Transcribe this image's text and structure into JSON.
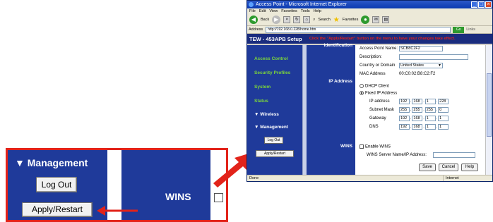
{
  "browser": {
    "title": "Access Point - Microsoft Internet Explorer",
    "menu": [
      "File",
      "Edit",
      "View",
      "Favorites",
      "Tools",
      "Help"
    ],
    "toolbar": {
      "back": "Back",
      "search": "Search",
      "favorites": "Favorites"
    },
    "address_label": "Address",
    "address_value": "http://192.168.0.228/home.htm",
    "go_label": "Go",
    "links_label": "Links",
    "status_left": "Done",
    "status_zone": "Internet"
  },
  "header": {
    "model": "TEW - 453APB Setup",
    "notice": "Click the \"Apply/Restart\" button on the menu to have your changes take effect."
  },
  "nav": {
    "items": [
      "Access Control",
      "Security Profiles",
      "System",
      "Status",
      "▼ Wireless",
      "▼ Management"
    ],
    "logout_label": "Log Out",
    "apply_label": "Apply/Restart"
  },
  "sections": {
    "identification": "Identification",
    "ip_address": "IP Address",
    "wins": "WINS"
  },
  "form": {
    "ap_name_label": "Access Point Name:",
    "ap_name_value": "SCB8C2F2",
    "description_label": "Description:",
    "description_value": "",
    "country_label": "Country or Domain",
    "country_value": "United States",
    "mac_label": "MAC Address",
    "mac_value": "00:C0:02:B8:C2:F2",
    "dhcp_label": "DHCP Client",
    "fixed_label": "Fixed IP Address",
    "ip_label": "IP address",
    "ip_value": [
      "192",
      "168",
      "1",
      "228"
    ],
    "mask_label": "Subnet Mask",
    "mask_value": [
      "255",
      "255",
      "255",
      "0"
    ],
    "gateway_label": "Gateway",
    "gateway_value": [
      "192",
      "168",
      "1",
      "1"
    ],
    "dns_label": "DNS",
    "dns_value": [
      "192",
      "168",
      "1",
      "1"
    ],
    "wins_enable_label": "Enable WINS",
    "wins_server_label": "WINS Server Name/IP Address:",
    "wins_server_value": "",
    "save_label": "Save",
    "cancel_label": "Cancel",
    "help_label": "Help"
  },
  "zoom": {
    "management_label": "▼ Management",
    "logout_label": "Log Out",
    "apply_label": "Apply/Restart",
    "wins_label": "WINS"
  },
  "colors": {
    "nav_bg": "#1f3a9a",
    "accent_green": "#7cd63a",
    "callout_red": "#e2231a"
  }
}
